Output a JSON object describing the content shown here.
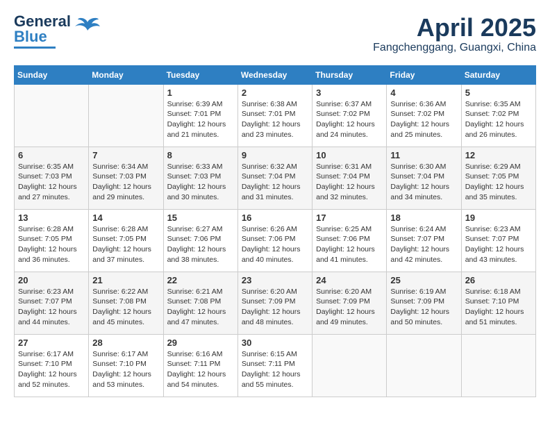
{
  "header": {
    "logo_line1": "General",
    "logo_line2": "Blue",
    "month_title": "April 2025",
    "location": "Fangchenggang, Guangxi, China"
  },
  "days_of_week": [
    "Sunday",
    "Monday",
    "Tuesday",
    "Wednesday",
    "Thursday",
    "Friday",
    "Saturday"
  ],
  "weeks": [
    [
      {
        "day": "",
        "info": ""
      },
      {
        "day": "",
        "info": ""
      },
      {
        "day": "1",
        "info": "Sunrise: 6:39 AM\nSunset: 7:01 PM\nDaylight: 12 hours\nand 21 minutes."
      },
      {
        "day": "2",
        "info": "Sunrise: 6:38 AM\nSunset: 7:01 PM\nDaylight: 12 hours\nand 23 minutes."
      },
      {
        "day": "3",
        "info": "Sunrise: 6:37 AM\nSunset: 7:02 PM\nDaylight: 12 hours\nand 24 minutes."
      },
      {
        "day": "4",
        "info": "Sunrise: 6:36 AM\nSunset: 7:02 PM\nDaylight: 12 hours\nand 25 minutes."
      },
      {
        "day": "5",
        "info": "Sunrise: 6:35 AM\nSunset: 7:02 PM\nDaylight: 12 hours\nand 26 minutes."
      }
    ],
    [
      {
        "day": "6",
        "info": "Sunrise: 6:35 AM\nSunset: 7:03 PM\nDaylight: 12 hours\nand 27 minutes."
      },
      {
        "day": "7",
        "info": "Sunrise: 6:34 AM\nSunset: 7:03 PM\nDaylight: 12 hours\nand 29 minutes."
      },
      {
        "day": "8",
        "info": "Sunrise: 6:33 AM\nSunset: 7:03 PM\nDaylight: 12 hours\nand 30 minutes."
      },
      {
        "day": "9",
        "info": "Sunrise: 6:32 AM\nSunset: 7:04 PM\nDaylight: 12 hours\nand 31 minutes."
      },
      {
        "day": "10",
        "info": "Sunrise: 6:31 AM\nSunset: 7:04 PM\nDaylight: 12 hours\nand 32 minutes."
      },
      {
        "day": "11",
        "info": "Sunrise: 6:30 AM\nSunset: 7:04 PM\nDaylight: 12 hours\nand 34 minutes."
      },
      {
        "day": "12",
        "info": "Sunrise: 6:29 AM\nSunset: 7:05 PM\nDaylight: 12 hours\nand 35 minutes."
      }
    ],
    [
      {
        "day": "13",
        "info": "Sunrise: 6:28 AM\nSunset: 7:05 PM\nDaylight: 12 hours\nand 36 minutes."
      },
      {
        "day": "14",
        "info": "Sunrise: 6:28 AM\nSunset: 7:05 PM\nDaylight: 12 hours\nand 37 minutes."
      },
      {
        "day": "15",
        "info": "Sunrise: 6:27 AM\nSunset: 7:06 PM\nDaylight: 12 hours\nand 38 minutes."
      },
      {
        "day": "16",
        "info": "Sunrise: 6:26 AM\nSunset: 7:06 PM\nDaylight: 12 hours\nand 40 minutes."
      },
      {
        "day": "17",
        "info": "Sunrise: 6:25 AM\nSunset: 7:06 PM\nDaylight: 12 hours\nand 41 minutes."
      },
      {
        "day": "18",
        "info": "Sunrise: 6:24 AM\nSunset: 7:07 PM\nDaylight: 12 hours\nand 42 minutes."
      },
      {
        "day": "19",
        "info": "Sunrise: 6:23 AM\nSunset: 7:07 PM\nDaylight: 12 hours\nand 43 minutes."
      }
    ],
    [
      {
        "day": "20",
        "info": "Sunrise: 6:23 AM\nSunset: 7:07 PM\nDaylight: 12 hours\nand 44 minutes."
      },
      {
        "day": "21",
        "info": "Sunrise: 6:22 AM\nSunset: 7:08 PM\nDaylight: 12 hours\nand 45 minutes."
      },
      {
        "day": "22",
        "info": "Sunrise: 6:21 AM\nSunset: 7:08 PM\nDaylight: 12 hours\nand 47 minutes."
      },
      {
        "day": "23",
        "info": "Sunrise: 6:20 AM\nSunset: 7:09 PM\nDaylight: 12 hours\nand 48 minutes."
      },
      {
        "day": "24",
        "info": "Sunrise: 6:20 AM\nSunset: 7:09 PM\nDaylight: 12 hours\nand 49 minutes."
      },
      {
        "day": "25",
        "info": "Sunrise: 6:19 AM\nSunset: 7:09 PM\nDaylight: 12 hours\nand 50 minutes."
      },
      {
        "day": "26",
        "info": "Sunrise: 6:18 AM\nSunset: 7:10 PM\nDaylight: 12 hours\nand 51 minutes."
      }
    ],
    [
      {
        "day": "27",
        "info": "Sunrise: 6:17 AM\nSunset: 7:10 PM\nDaylight: 12 hours\nand 52 minutes."
      },
      {
        "day": "28",
        "info": "Sunrise: 6:17 AM\nSunset: 7:10 PM\nDaylight: 12 hours\nand 53 minutes."
      },
      {
        "day": "29",
        "info": "Sunrise: 6:16 AM\nSunset: 7:11 PM\nDaylight: 12 hours\nand 54 minutes."
      },
      {
        "day": "30",
        "info": "Sunrise: 6:15 AM\nSunset: 7:11 PM\nDaylight: 12 hours\nand 55 minutes."
      },
      {
        "day": "",
        "info": ""
      },
      {
        "day": "",
        "info": ""
      },
      {
        "day": "",
        "info": ""
      }
    ]
  ]
}
